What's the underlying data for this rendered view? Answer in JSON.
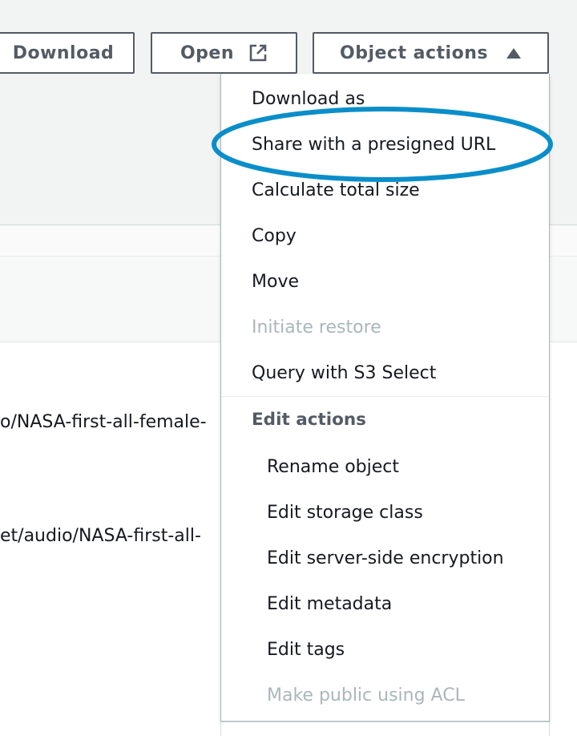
{
  "toolbar": {
    "download_label": "Download",
    "open_label": "Open",
    "object_actions_label": "Object actions"
  },
  "icons": {
    "open": "external-link-icon",
    "object_actions": "caret-up-icon"
  },
  "colors": {
    "highlight": "#0a8ec9",
    "text": "#16191f",
    "disabled": "#aab7b8",
    "button_border": "#545b64"
  },
  "table": {
    "rows": [
      "o/NASA-first-all-female-",
      "et/audio/NASA-first-all-"
    ]
  },
  "menu": {
    "items": [
      "Download as",
      "Share with a presigned URL",
      "Calculate total size",
      "Copy",
      "Move",
      "Initiate restore",
      "Query with S3 Select"
    ],
    "edit_header": "Edit actions",
    "edit_items": [
      "Rename object",
      "Edit storage class",
      "Edit server-side encryption",
      "Edit metadata",
      "Edit tags",
      "Make public using ACL"
    ]
  }
}
